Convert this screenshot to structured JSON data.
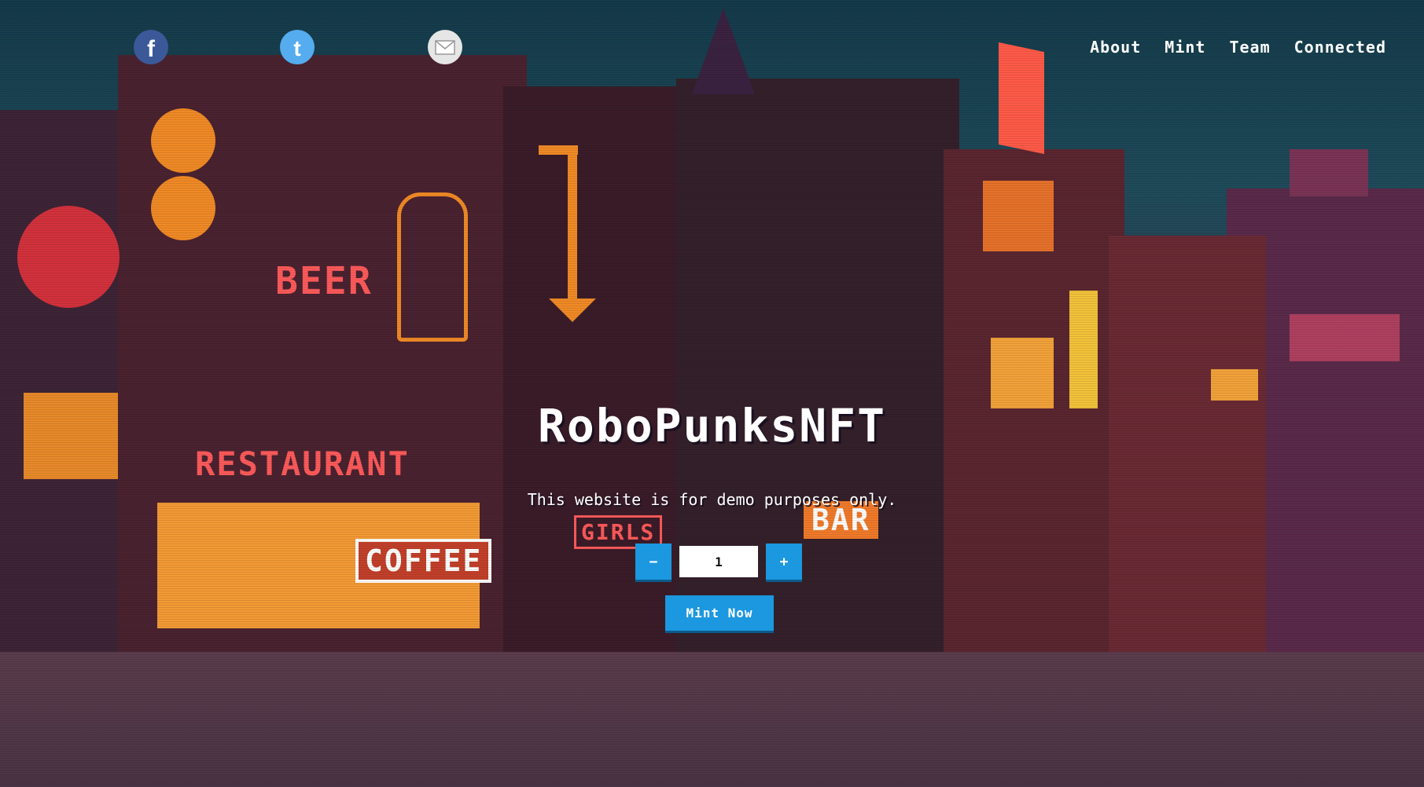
{
  "social": [
    {
      "name": "facebook",
      "icon": "facebook-icon"
    },
    {
      "name": "twitter",
      "icon": "twitter-icon"
    },
    {
      "name": "email",
      "icon": "email-icon"
    }
  ],
  "nav": {
    "about": "About",
    "mint": "Mint",
    "team": "Team",
    "connected": "Connected"
  },
  "hero": {
    "title": "RoboPunksNFT",
    "subtitle": "This website is for demo purposes only.",
    "decrement_label": "−",
    "quantity": "1",
    "increment_label": "+",
    "mint_label": "Mint Now"
  },
  "scene_signs": {
    "beer": "BEER",
    "restaurant": "RESTAURANT",
    "coffee": "COFFEE",
    "girls": "GIRLS",
    "bar": "BAR"
  },
  "colors": {
    "accent": "#1b98e0",
    "text": "#ffffff"
  }
}
